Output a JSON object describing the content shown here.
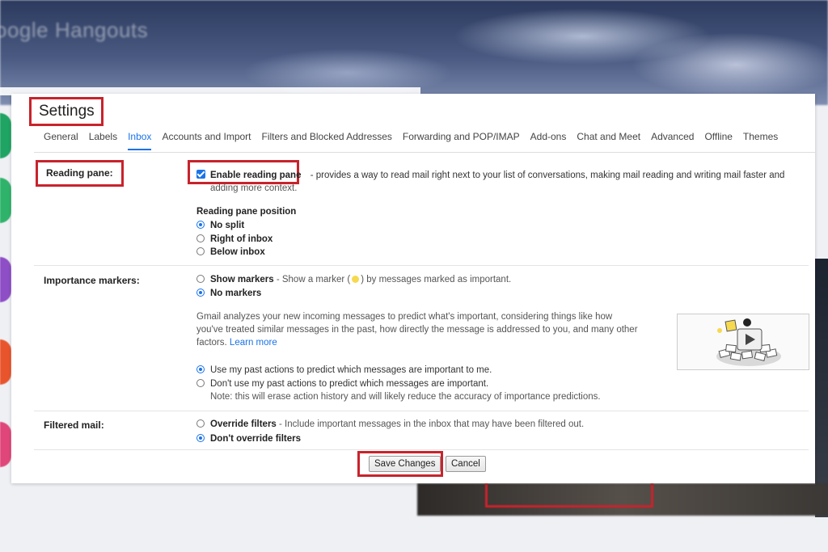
{
  "background": {
    "app_title": "oogle Hangouts"
  },
  "settings": {
    "title": "Settings",
    "tabs": [
      {
        "label": "General"
      },
      {
        "label": "Labels"
      },
      {
        "label": "Inbox",
        "active": true
      },
      {
        "label": "Accounts and Import"
      },
      {
        "label": "Filters and Blocked Addresses"
      },
      {
        "label": "Forwarding and POP/IMAP"
      },
      {
        "label": "Add-ons"
      },
      {
        "label": "Chat and Meet"
      },
      {
        "label": "Advanced"
      },
      {
        "label": "Offline"
      },
      {
        "label": "Themes"
      }
    ]
  },
  "reading_pane": {
    "label": "Reading pane:",
    "enable_label": "Enable reading pane",
    "enable_checked": true,
    "description_1": "- provides a way to read mail right next to your list of conversations, making mail reading and writing mail faster and",
    "description_2": "adding more context.",
    "position_heading": "Reading pane position",
    "options": [
      {
        "label": "No split",
        "selected": true
      },
      {
        "label": "Right of inbox",
        "selected": false
      },
      {
        "label": "Below inbox",
        "selected": false
      }
    ]
  },
  "importance": {
    "label": "Importance markers:",
    "show_markers": "Show markers",
    "show_desc_pre": "- Show a marker (",
    "show_desc_post": ") by messages marked as important.",
    "no_markers": "No markers",
    "analysis_1": "Gmail analyzes your new incoming messages to predict what's important, considering things like how",
    "analysis_2": "you've treated similar messages in the past, how directly the message is addressed to you, and many other",
    "analysis_3": "factors.",
    "learn_more": "Learn more",
    "use_past": "Use my past actions to predict which messages are important to me.",
    "dont_use_past": "Don't use my past actions to predict which messages are important.",
    "note": "Note: this will erase action history and will likely reduce the accuracy of importance predictions."
  },
  "filtered": {
    "label": "Filtered mail:",
    "override": "Override filters",
    "override_desc": "- Include important messages in the inbox that may have been filtered out.",
    "dont_override": "Don't override filters"
  },
  "actions": {
    "save": "Save Changes",
    "cancel": "Cancel"
  },
  "colors": {
    "accent": "#1a73e8",
    "highlight": "#c8232c"
  }
}
